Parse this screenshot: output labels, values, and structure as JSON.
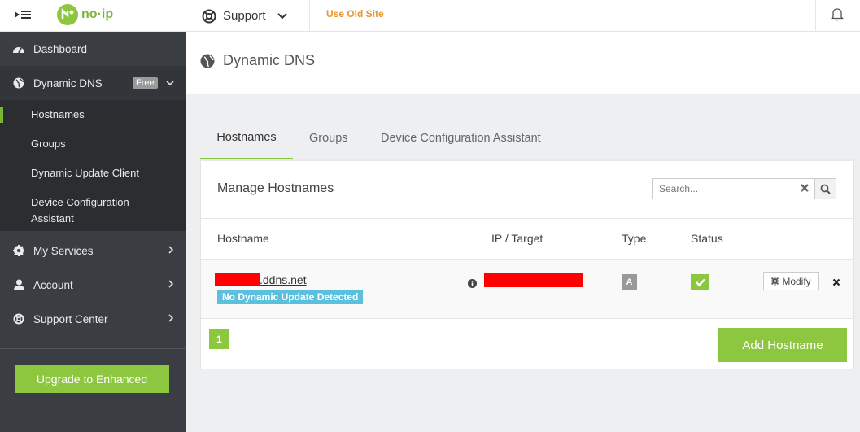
{
  "topbar": {
    "logo_text": "no·ip",
    "support_label": "Support",
    "old_site_label": "Use Old Site"
  },
  "sidebar": {
    "dashboard": "Dashboard",
    "dynamic_dns": "Dynamic DNS",
    "free_badge": "Free",
    "submenu": [
      "Hostnames",
      "Groups",
      "Dynamic Update Client",
      "Device Configuration",
      "Assistant"
    ],
    "my_services": "My Services",
    "account": "Account",
    "support_center": "Support Center",
    "upgrade_label": "Upgrade to Enhanced"
  },
  "header": {
    "title": "Dynamic DNS"
  },
  "tabs": [
    "Hostnames",
    "Groups",
    "Device Configuration Assistant"
  ],
  "panel": {
    "title": "Manage Hostnames",
    "search_placeholder": "Search...",
    "columns": [
      "Hostname",
      "IP / Target",
      "Type",
      "Status"
    ],
    "rows": [
      {
        "hostname_suffix": ".ddns.net",
        "warning": "No Dynamic Update Detected",
        "type": "A",
        "modify_label": "Modify"
      }
    ],
    "page": "1",
    "add_label": "Add Hostname"
  },
  "colors": {
    "accent": "#8dc63f",
    "sidebar_bg": "#3a3d42",
    "old_site": "#e8962a",
    "info_badge": "#5bc0de",
    "redaction": "#ff0000"
  }
}
